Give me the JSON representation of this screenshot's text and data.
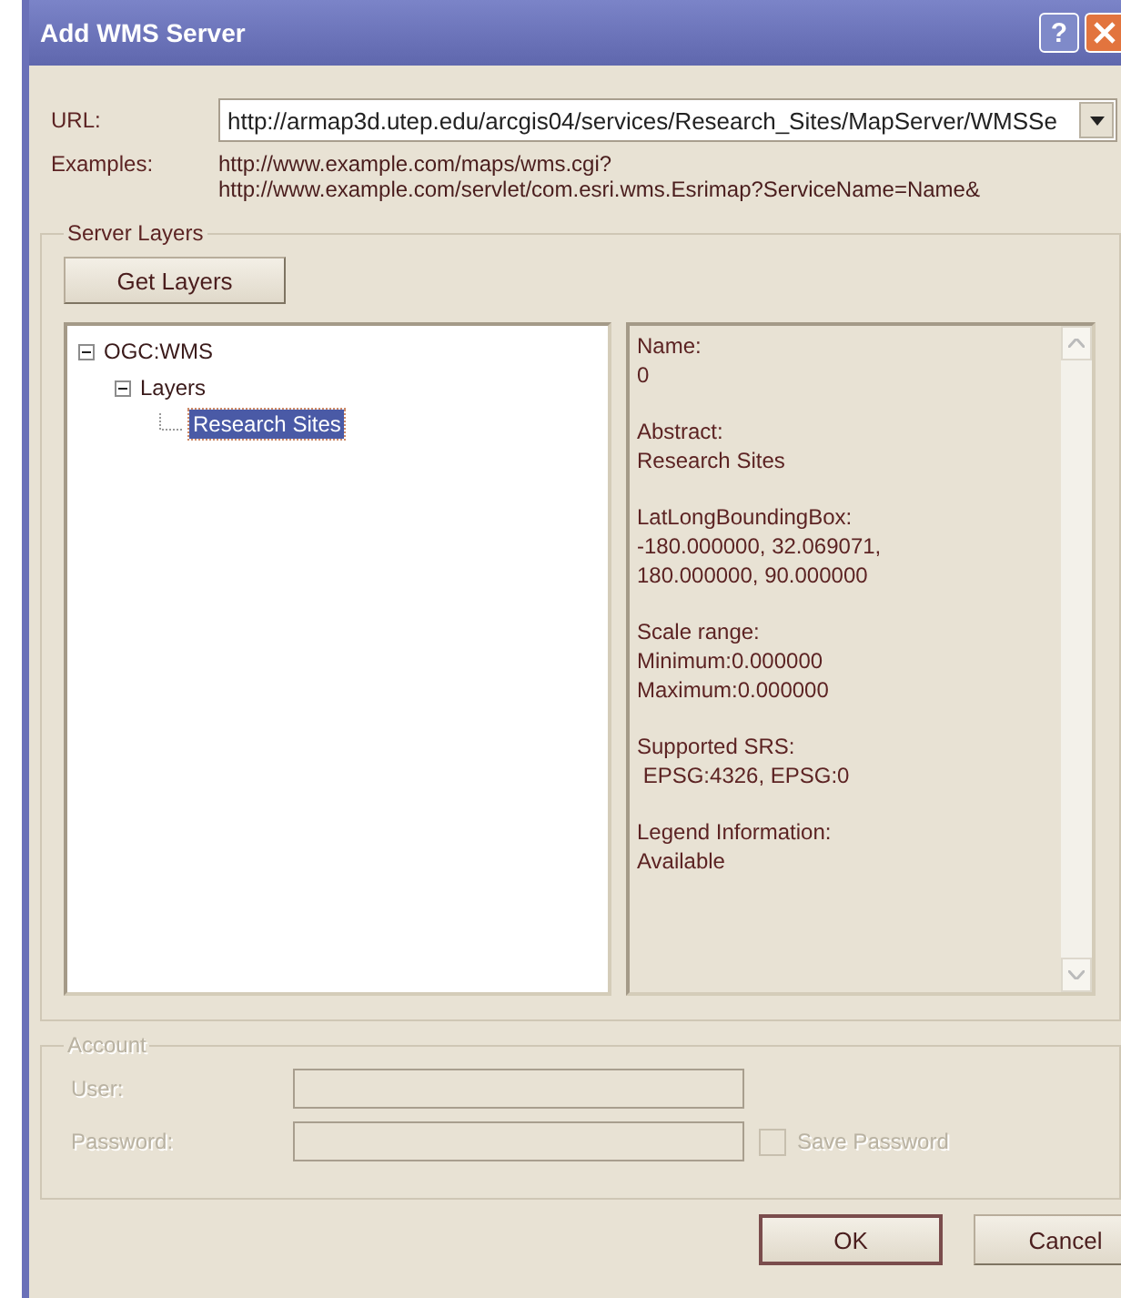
{
  "window": {
    "title": "Add WMS Server",
    "help_button": "?"
  },
  "url": {
    "label": "URL:",
    "value": "http://armap3d.utep.edu/arcgis04/services/Research_Sites/MapServer/WMSSe"
  },
  "examples": {
    "label": "Examples:",
    "lines": [
      "http://www.example.com/maps/wms.cgi?",
      "http://www.example.com/servlet/com.esri.wms.Esrimap?ServiceName=Name&"
    ]
  },
  "server_layers": {
    "title": "Server Layers",
    "get_layers_button": "Get Layers",
    "tree": [
      {
        "label": "OGC:WMS",
        "expanded": true,
        "selected": false,
        "children": [
          {
            "label": "Layers",
            "expanded": true,
            "selected": false,
            "children": [
              {
                "label": "Research Sites",
                "selected": true
              }
            ]
          }
        ]
      }
    ],
    "details": [
      {
        "label": "Name:",
        "lines": [
          "0"
        ]
      },
      {
        "label": "Abstract:",
        "lines": [
          "Research Sites"
        ]
      },
      {
        "label": "LatLongBoundingBox:",
        "lines": [
          "-180.000000, 32.069071,",
          "180.000000, 90.000000"
        ]
      },
      {
        "label": "Scale range:",
        "lines": [
          "Minimum:0.000000",
          "Maximum:0.000000"
        ]
      },
      {
        "label": "Supported SRS:",
        "lines": [
          " EPSG:4326, EPSG:0"
        ]
      },
      {
        "label": "Legend Information:",
        "lines": [
          "Available"
        ]
      }
    ]
  },
  "account": {
    "title": "Account",
    "disabled": true,
    "user_label": "User:",
    "password_label": "Password:",
    "save_password": {
      "label": "Save Password",
      "checked": false
    }
  },
  "buttons": [
    {
      "label": "OK",
      "default": true
    },
    {
      "label": "Cancel",
      "default": false
    }
  ]
}
